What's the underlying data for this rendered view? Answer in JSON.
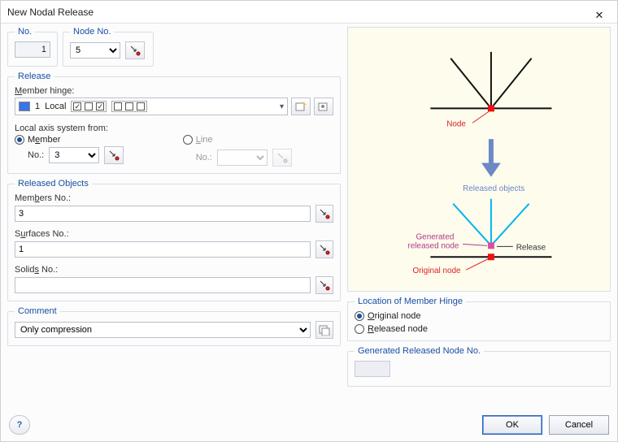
{
  "window": {
    "title": "New Nodal Release"
  },
  "top": {
    "no_group": "No.",
    "no_value": "1",
    "nodeno_group": "Node No.",
    "nodeno_value": "5"
  },
  "release": {
    "legend": "Release",
    "member_hinge_label": "Member hinge:",
    "hinge_num": "1",
    "hinge_type": "Local",
    "axis_label": "Local axis system from:",
    "member_radio": "Member",
    "line_radio": "Line",
    "member_no_label": "No.:",
    "member_no_value": "3",
    "line_no_label": "No.:",
    "line_no_value": ""
  },
  "released": {
    "legend": "Released Objects",
    "members_label": "Members No.:",
    "members_value": "3",
    "surfaces_label": "Surfaces No.:",
    "surfaces_value": "1",
    "solids_label": "Solids No.:",
    "solids_value": ""
  },
  "comment": {
    "legend": "Comment",
    "value": "Only compression"
  },
  "diagram": {
    "node": "Node",
    "released_objects": "Released objects",
    "generated": "Generated",
    "released_node": "released node",
    "release": "Release",
    "original_node": "Original node"
  },
  "location": {
    "legend": "Location of Member Hinge",
    "original": "Original node",
    "released": "Released node"
  },
  "generated": {
    "legend": "Generated Released Node No."
  },
  "buttons": {
    "ok": "OK",
    "cancel": "Cancel"
  }
}
